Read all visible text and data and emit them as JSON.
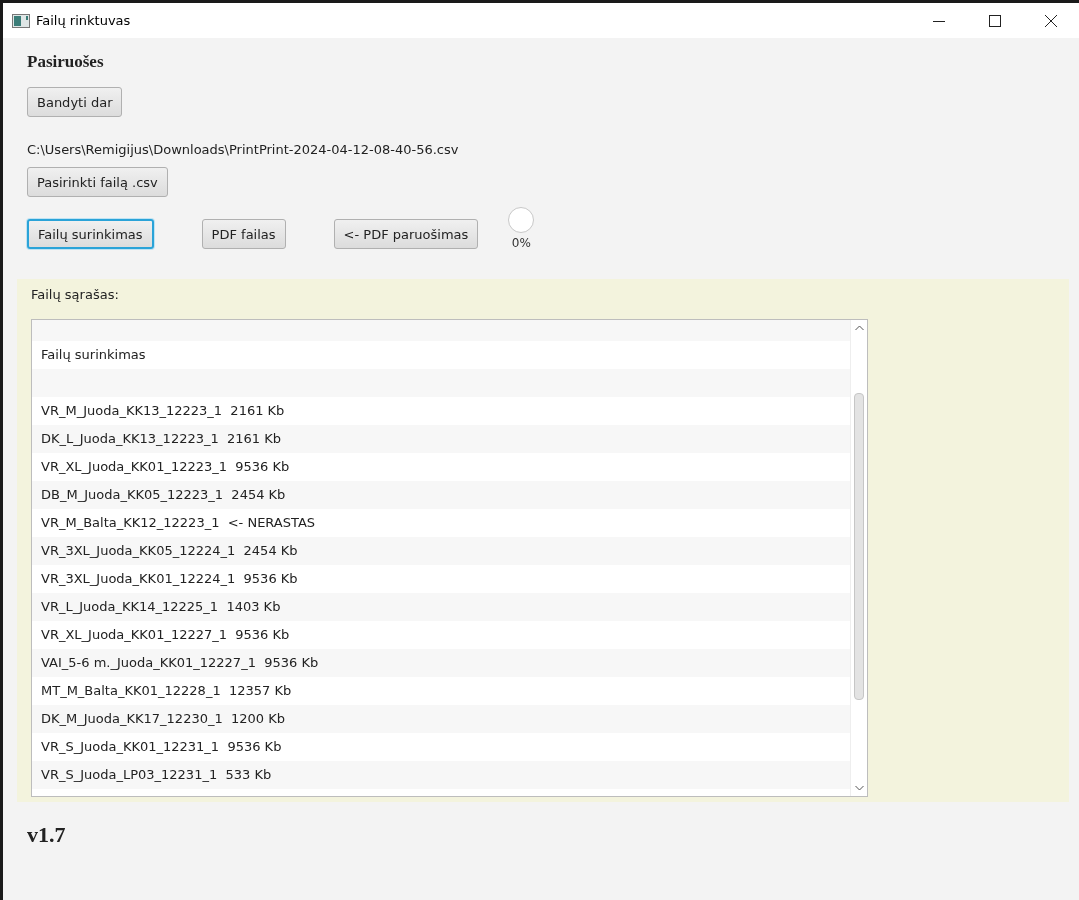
{
  "window": {
    "title": "Failų rinktuvas"
  },
  "heading": "Pasiruošes",
  "retry_button": {
    "label": "Bandyti dar"
  },
  "file_path": "C:\\Users\\Remigijus\\Downloads\\PrintPrint-2024-04-12-08-40-56.csv",
  "choose_button": {
    "label": "Pasirinkti failą .csv"
  },
  "actions": [
    {
      "label": "Failų surinkimas",
      "focused": true
    },
    {
      "label": "PDF failas",
      "focused": false
    },
    {
      "label": "<- PDF paruošimas",
      "focused": false
    }
  ],
  "progress": {
    "level": 0,
    "reading": "0%"
  },
  "list_panel": {
    "label": "Failų sąrašas:",
    "items": [
      {
        "kind": "blank"
      },
      {
        "kind": "text",
        "text": "Failų surinkimas"
      },
      {
        "kind": "blank"
      },
      {
        "kind": "text",
        "text": "VR_M_Juoda_KK13_12223_1  2161 Kb"
      },
      {
        "kind": "text",
        "text": "DK_L_Juoda_KK13_12223_1  2161 Kb"
      },
      {
        "kind": "text",
        "text": "VR_XL_Juoda_KK01_12223_1  9536 Kb"
      },
      {
        "kind": "text",
        "text": "DB_M_Juoda_KK05_12223_1  2454 Kb"
      },
      {
        "kind": "text",
        "text": "VR_M_Balta_KK12_12223_1  <- NERASTAS"
      },
      {
        "kind": "text",
        "text": "VR_3XL_Juoda_KK05_12224_1  2454 Kb"
      },
      {
        "kind": "text",
        "text": "VR_3XL_Juoda_KK01_12224_1  9536 Kb"
      },
      {
        "kind": "text",
        "text": "VR_L_Juoda_KK14_12225_1  1403 Kb"
      },
      {
        "kind": "text",
        "text": "VR_XL_Juoda_KK01_12227_1  9536 Kb"
      },
      {
        "kind": "text",
        "text": "VAI_5-6 m._Juoda_KK01_12227_1  9536 Kb"
      },
      {
        "kind": "text",
        "text": "MT_M_Balta_KK01_12228_1  12357 Kb"
      },
      {
        "kind": "text",
        "text": "DK_M_Juoda_KK17_12230_1  1200 Kb"
      },
      {
        "kind": "text",
        "text": "VR_S_Juoda_KK01_12231_1  9536 Kb"
      },
      {
        "kind": "text",
        "text": "VR_S_Juoda_LP03_12231_1  533 Kb"
      }
    ]
  },
  "version": "v1.7"
}
